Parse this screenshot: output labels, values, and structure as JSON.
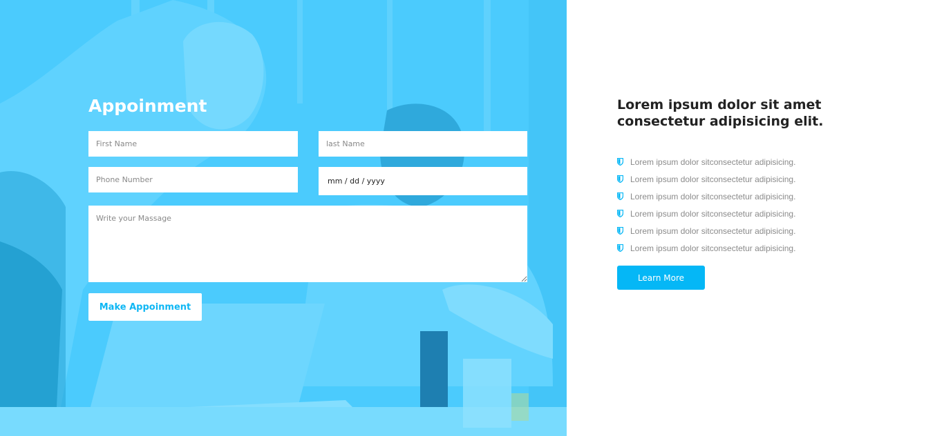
{
  "colors": {
    "overlay": "#4bcbfd",
    "accent": "#05b7f6",
    "heading": "#222222",
    "muted": "#8a8a8a"
  },
  "appointment": {
    "title": "Appoinment",
    "first_name_placeholder": "First Name",
    "last_name_placeholder": "last Name",
    "phone_placeholder": "Phone Number",
    "date_value": "mm / dd / yyyy",
    "message_placeholder": "Write your Massage",
    "submit_label": "Make Appoinment"
  },
  "info": {
    "title": "Lorem ipsum dolor sit amet consectetur adipisicing elit.",
    "features": [
      {
        "icon": "shield-icon",
        "text": "Lorem ipsum dolor sitconsectetur adipisicing."
      },
      {
        "icon": "shield-icon",
        "text": "Lorem ipsum dolor sitconsectetur adipisicing."
      },
      {
        "icon": "shield-icon",
        "text": "Lorem ipsum dolor sitconsectetur adipisicing."
      },
      {
        "icon": "shield-icon",
        "text": "Lorem ipsum dolor sitconsectetur adipisicing."
      },
      {
        "icon": "shield-icon",
        "text": "Lorem ipsum dolor sitconsectetur adipisicing."
      },
      {
        "icon": "shield-icon",
        "text": "Lorem ipsum dolor sitconsectetur adipisicing."
      }
    ],
    "learn_more_label": "Learn More"
  }
}
